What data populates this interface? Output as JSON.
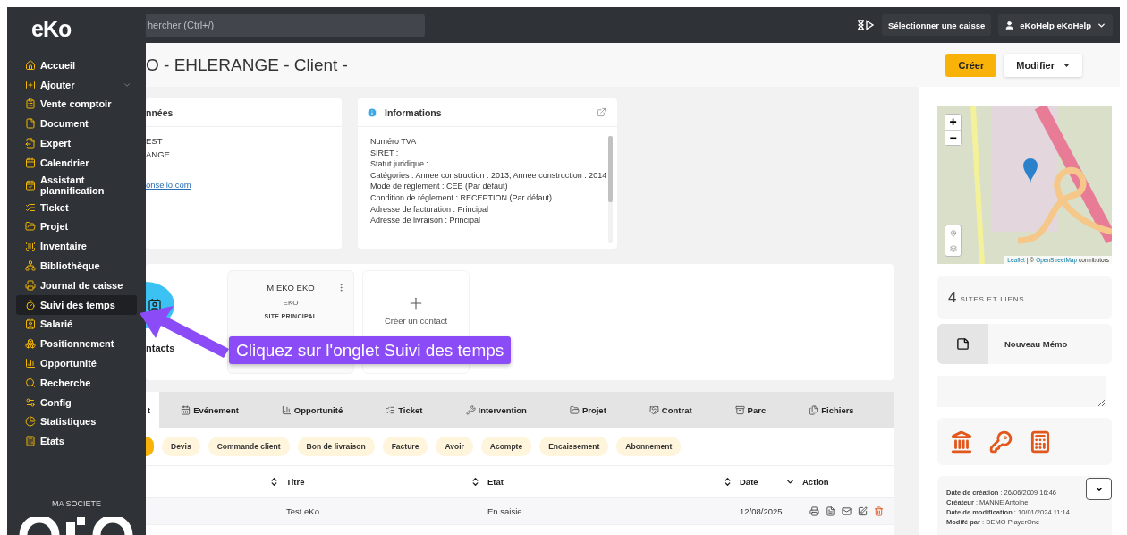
{
  "sidebar": {
    "logo": "eKo",
    "items": [
      {
        "label": "Accueil",
        "selected": false,
        "expandable": false
      },
      {
        "label": "Ajouter",
        "selected": false,
        "expandable": true
      },
      {
        "label": "Vente comptoir",
        "selected": false,
        "expandable": false
      },
      {
        "label": "Document",
        "selected": false,
        "expandable": false
      },
      {
        "label": "Expert",
        "selected": false,
        "expandable": false
      },
      {
        "label": "Calendrier",
        "selected": false,
        "expandable": false
      },
      {
        "label": "Assistant plannification",
        "selected": false,
        "expandable": false
      },
      {
        "label": "Ticket",
        "selected": false,
        "expandable": false
      },
      {
        "label": "Projet",
        "selected": false,
        "expandable": false
      },
      {
        "label": "Inventaire",
        "selected": false,
        "expandable": false
      },
      {
        "label": "Bibliothèque",
        "selected": false,
        "expandable": false
      },
      {
        "label": "Journal de caisse",
        "selected": false,
        "expandable": false
      },
      {
        "label": "Suivi des temps",
        "selected": true,
        "expandable": false
      },
      {
        "label": "Salarié",
        "selected": false,
        "expandable": false
      },
      {
        "label": "Positionnement",
        "selected": false,
        "expandable": false
      },
      {
        "label": "Opportunité",
        "selected": false,
        "expandable": false
      },
      {
        "label": "Recherche",
        "selected": false,
        "expandable": false
      },
      {
        "label": "Config",
        "selected": false,
        "expandable": false
      },
      {
        "label": "Statistiques",
        "selected": false,
        "expandable": false
      },
      {
        "label": "Etats",
        "selected": false,
        "expandable": false
      }
    ],
    "company": "MA SOCIETE"
  },
  "topbar": {
    "search": {
      "placeholder": "hercher (Ctrl+/)"
    },
    "register_button": "Sélectionner une caisse",
    "user": "eKoHelp eKoHelp"
  },
  "header": {
    "title": "O - EHLERANGE - Client -",
    "buttons": [
      {
        "label": "Créer",
        "kind": "primary"
      },
      {
        "label": "Modifier",
        "kind": "dropdown"
      }
    ]
  },
  "coordinates_card": {
    "title": "nnées",
    "lines": [
      "EST",
      "ANGE"
    ],
    "link": "onselio.com"
  },
  "information_card": {
    "title": "Informations",
    "fields": [
      "Numéro TVA :",
      "SIRET :",
      "Statut juridique :",
      "Catégories : Annee construction : 2013, Annee construction : 2014",
      "Mode de réglement : CEE (Par défaut)",
      "Condition de réglement : RECEPTION (Par défaut)",
      "Adresse de facturation : Principal",
      "Adresse de livraison : Principal"
    ]
  },
  "contacts": {
    "title": "ntacts",
    "cards": [
      {
        "name": "M EKO EKO",
        "company": "EKO",
        "site": "SITE PRINCIPAL"
      }
    ],
    "create_label": "Créer un contact"
  },
  "callout": {
    "text": "Cliquez sur l'onglet Suivi des temps"
  },
  "tabs": [
    {
      "label": "t",
      "selected": true
    },
    {
      "label": "Evénement",
      "selected": false
    },
    {
      "label": "Opportunité",
      "selected": false
    },
    {
      "label": "Ticket",
      "selected": false
    },
    {
      "label": "Intervention",
      "selected": false
    },
    {
      "label": "Projet",
      "selected": false
    },
    {
      "label": "Contrat",
      "selected": false
    },
    {
      "label": "Parc",
      "selected": false
    },
    {
      "label": "Fichiers",
      "selected": false
    }
  ],
  "filters": {
    "cut_chip_selected": true,
    "chips": [
      {
        "label": "Devis",
        "selected": false
      },
      {
        "label": "Commande client",
        "selected": false
      },
      {
        "label": "Bon de livraison",
        "selected": false
      },
      {
        "label": "Facture",
        "selected": false
      },
      {
        "label": "Avoir",
        "selected": false
      },
      {
        "label": "Acompte",
        "selected": false
      },
      {
        "label": "Encaissement",
        "selected": false
      },
      {
        "label": "Abonnement",
        "selected": false
      }
    ]
  },
  "table": {
    "columns": [
      {
        "sortable": true
      },
      {
        "label": "Titre",
        "sortable": true
      },
      {
        "label": "Etat",
        "sortable": true
      },
      {
        "label": "Date",
        "sortable": true,
        "descending": true
      },
      {
        "label": "Action",
        "sortable": false
      }
    ],
    "rows": [
      {
        "cells": [
          "",
          "Test eKo",
          "En saisie",
          "12/08/2025"
        ]
      }
    ]
  },
  "map": {
    "zoom_in": "+",
    "zoom_out": "−",
    "attribution_link": "Leaflet",
    "attribution_sep": "| ©",
    "attribution_osm": "OpenStreetMap",
    "attribution_rest": "contributors"
  },
  "sites": {
    "count": "4",
    "label": "SITES ET LIENS"
  },
  "memo": {
    "label": "Nouveau Mémo"
  },
  "meta": [
    "**Date de création** : 26/06/2009 16:46",
    "**Créateur** : MANNE Antoine",
    "**Date de modification** : 10/01/2024 11:14",
    "**Modifé par** : DEMO PlayerOne"
  ]
}
